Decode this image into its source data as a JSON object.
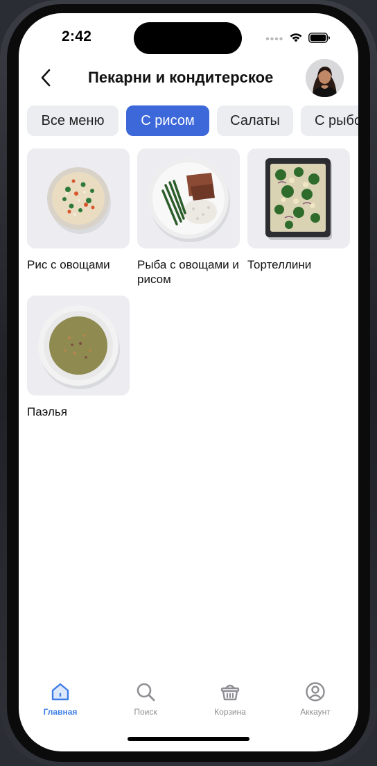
{
  "status": {
    "time": "2:42"
  },
  "header": {
    "title": "Пекарни и кондитерское"
  },
  "tabs": [
    {
      "label": "Все меню",
      "active": false
    },
    {
      "label": "С рисом",
      "active": true
    },
    {
      "label": "Салаты",
      "active": false
    },
    {
      "label": "С рыбой",
      "active": false
    }
  ],
  "items": [
    {
      "label": "Рис с овощами",
      "image": "rice-bowl-image"
    },
    {
      "label": "Рыба с овощами и рисом",
      "image": "fish-plate-image"
    },
    {
      "label": "Тортеллини",
      "image": "tortellini-tray-image"
    },
    {
      "label": "Паэлья",
      "image": "soup-plate-image"
    }
  ],
  "tabbar": [
    {
      "label": "Главная",
      "icon": "home-icon",
      "active": true
    },
    {
      "label": "Поиск",
      "icon": "search-icon",
      "active": false
    },
    {
      "label": "Корзина",
      "icon": "basket-icon",
      "active": false
    },
    {
      "label": "Аккаунт",
      "icon": "account-icon",
      "active": false
    }
  ],
  "colors": {
    "accent": "#3c68d9",
    "tab_active_text": "#3c7de6",
    "chip_bg": "#ecedf1"
  }
}
